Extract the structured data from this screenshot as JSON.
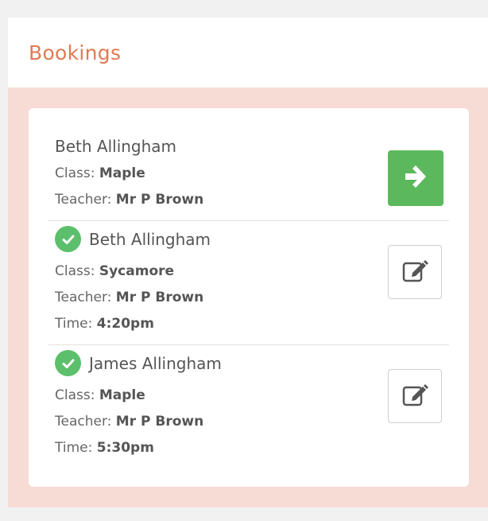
{
  "panel": {
    "title": "Bookings"
  },
  "bookings": [
    {
      "name": "Beth Allingham",
      "class_label": "Class:",
      "class_value": "Maple",
      "teacher_label": "Teacher:",
      "teacher_value": "Mr P Brown",
      "time_label": "",
      "time_value": "",
      "confirmed": false,
      "action_icon": "arrow-right-icon",
      "action": "go"
    },
    {
      "name": "Beth Allingham",
      "class_label": "Class:",
      "class_value": "Sycamore",
      "teacher_label": "Teacher:",
      "teacher_value": "Mr P Brown",
      "time_label": "Time:",
      "time_value": "4:20pm",
      "confirmed": true,
      "action_icon": "edit-icon",
      "action": "edit"
    },
    {
      "name": "James Allingham",
      "class_label": "Class:",
      "class_value": "Maple",
      "teacher_label": "Teacher:",
      "teacher_value": "Mr P Brown",
      "time_label": "Time:",
      "time_value": "5:30pm",
      "confirmed": true,
      "action_icon": "edit-icon",
      "action": "edit"
    }
  ],
  "colors": {
    "accent": "#e07a52",
    "panel_bg": "#f7dbd5",
    "success": "#5cb85c",
    "check": "#5cbf6b"
  }
}
